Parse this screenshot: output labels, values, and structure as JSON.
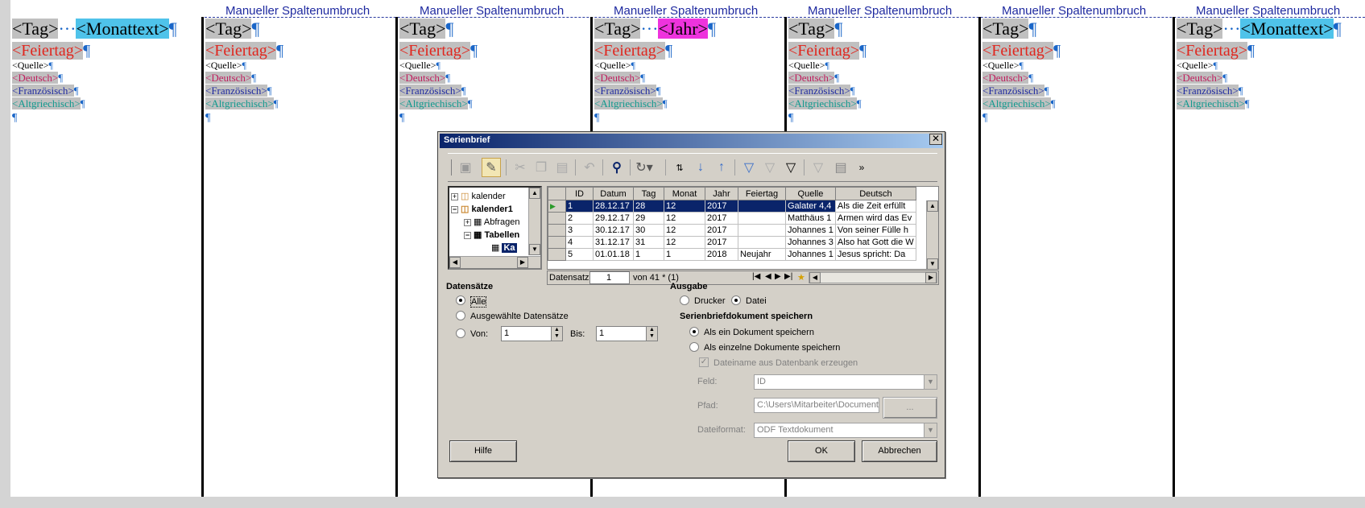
{
  "break_label": "Manueller Spaltenumbruch",
  "fields": {
    "tag": "<Tag>",
    "monattext": "<Monattext>",
    "jahr": "<Jahr>",
    "feiertag": "<Feiertag>",
    "quelle": "<Quelle>",
    "deutsch": "<Deutsch>",
    "franzoesisch": "<Französisch>",
    "altgriechisch": "<Altgriechisch>",
    "pilcrow": "¶",
    "dots": "···"
  },
  "dialog": {
    "title": "Serienbrief",
    "close": "✕",
    "toolbar_icons": [
      "save-icon",
      "edit-icon",
      "cut-icon",
      "copy-icon",
      "paste-icon",
      "undo-icon",
      "find-icon",
      "refresh-icon",
      "sort-icon",
      "sort-ascending-icon",
      "sort-descending-icon",
      "autofilter-icon",
      "standard-filter-icon",
      "filter-icon",
      "remove-filter-icon",
      "data-to-text-icon",
      "more-icon"
    ],
    "tree": {
      "items": [
        "kalender",
        "kalender1",
        "Abfragen",
        "Tabellen",
        "Ka"
      ]
    },
    "grid": {
      "columns": [
        "ID",
        "Datum",
        "Tag",
        "Monat",
        "Jahr",
        "Feiertag",
        "Quelle",
        "Deutsch"
      ],
      "rows": [
        [
          "1",
          "28.12.17",
          "28",
          "12",
          "2017",
          "",
          "Galater 4,4",
          "Als die Zeit erfüllt"
        ],
        [
          "2",
          "29.12.17",
          "29",
          "12",
          "2017",
          "",
          "Matthäus 1",
          "Armen wird das Ev"
        ],
        [
          "3",
          "30.12.17",
          "30",
          "12",
          "2017",
          "",
          "Johannes 1",
          "Von seiner Fülle h"
        ],
        [
          "4",
          "31.12.17",
          "31",
          "12",
          "2017",
          "",
          "Johannes 3",
          "Also hat Gott die W"
        ],
        [
          "5",
          "01.01.18",
          "1",
          "1",
          "2018",
          "Neujahr",
          "Johannes 1",
          "Jesus spricht: Da"
        ]
      ],
      "nav_label": "Datensatz",
      "nav_value": "1",
      "nav_of": "von 41 * (1)"
    },
    "records": {
      "heading": "Datensätze",
      "all": "Alle",
      "selected": "Ausgewählte Datensätze",
      "from": "Von:",
      "from_value": "1",
      "to": "Bis:",
      "to_value": "1"
    },
    "output": {
      "heading": "Ausgabe",
      "printer": "Drucker",
      "file": "Datei",
      "save_heading": "Serienbriefdokument speichern",
      "as_one": "Als ein Dokument speichern",
      "as_single": "Als einzelne Dokumente speichern",
      "filename_from_db": "Dateiname aus Datenbank erzeugen",
      "field_label": "Feld:",
      "field_value": "ID",
      "path_label": "Pfad:",
      "path_value": "C:\\Users\\Mitarbeiter\\Document",
      "browse": "...",
      "format_label": "Dateiformat:",
      "format_value": "ODF Textdokument"
    },
    "buttons": {
      "help": "Hilfe",
      "ok": "OK",
      "cancel": "Abbrechen"
    }
  }
}
